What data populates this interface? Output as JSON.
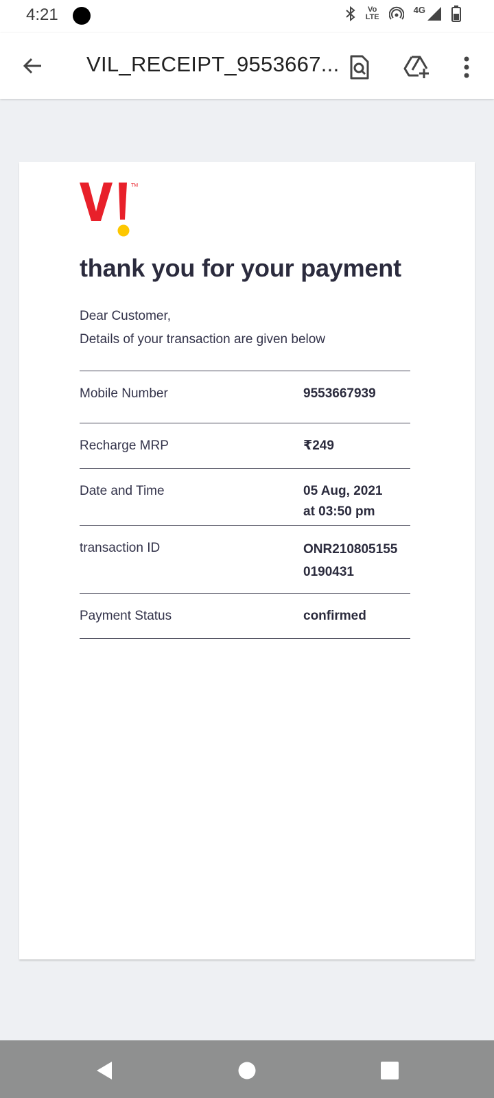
{
  "status_bar": {
    "time": "4:21",
    "volte_top": "Vo",
    "volte_bottom": "LTE",
    "network": "4G"
  },
  "toolbar": {
    "title": "VIL_RECEIPT_9553667...",
    "icons": [
      "back-arrow-icon",
      "find-in-document-icon",
      "add-to-drive-icon",
      "more-vert-icon"
    ]
  },
  "receipt": {
    "brand_colors": {
      "red": "#e8202a",
      "yellow": "#fdc700"
    },
    "heading": "thank you for your payment",
    "greeting": "Dear Customer,",
    "intro": "Details of your transaction are given below",
    "rows": [
      {
        "label": "Mobile Number",
        "value_lines": [
          "9553667939"
        ]
      },
      {
        "label": "Recharge MRP",
        "value_lines": [
          "₹249"
        ]
      },
      {
        "label": "Date and Time",
        "value_lines": [
          "05 Aug, 2021",
          "at 03:50 pm"
        ]
      },
      {
        "label": "transaction ID",
        "value_lines": [
          "ONR210805155",
          "0190431"
        ]
      },
      {
        "label": "Payment Status",
        "value_lines": [
          "confirmed"
        ]
      }
    ]
  },
  "nav_bar": {
    "icons": [
      "nav-back-icon",
      "nav-home-icon",
      "nav-recents-icon"
    ]
  }
}
